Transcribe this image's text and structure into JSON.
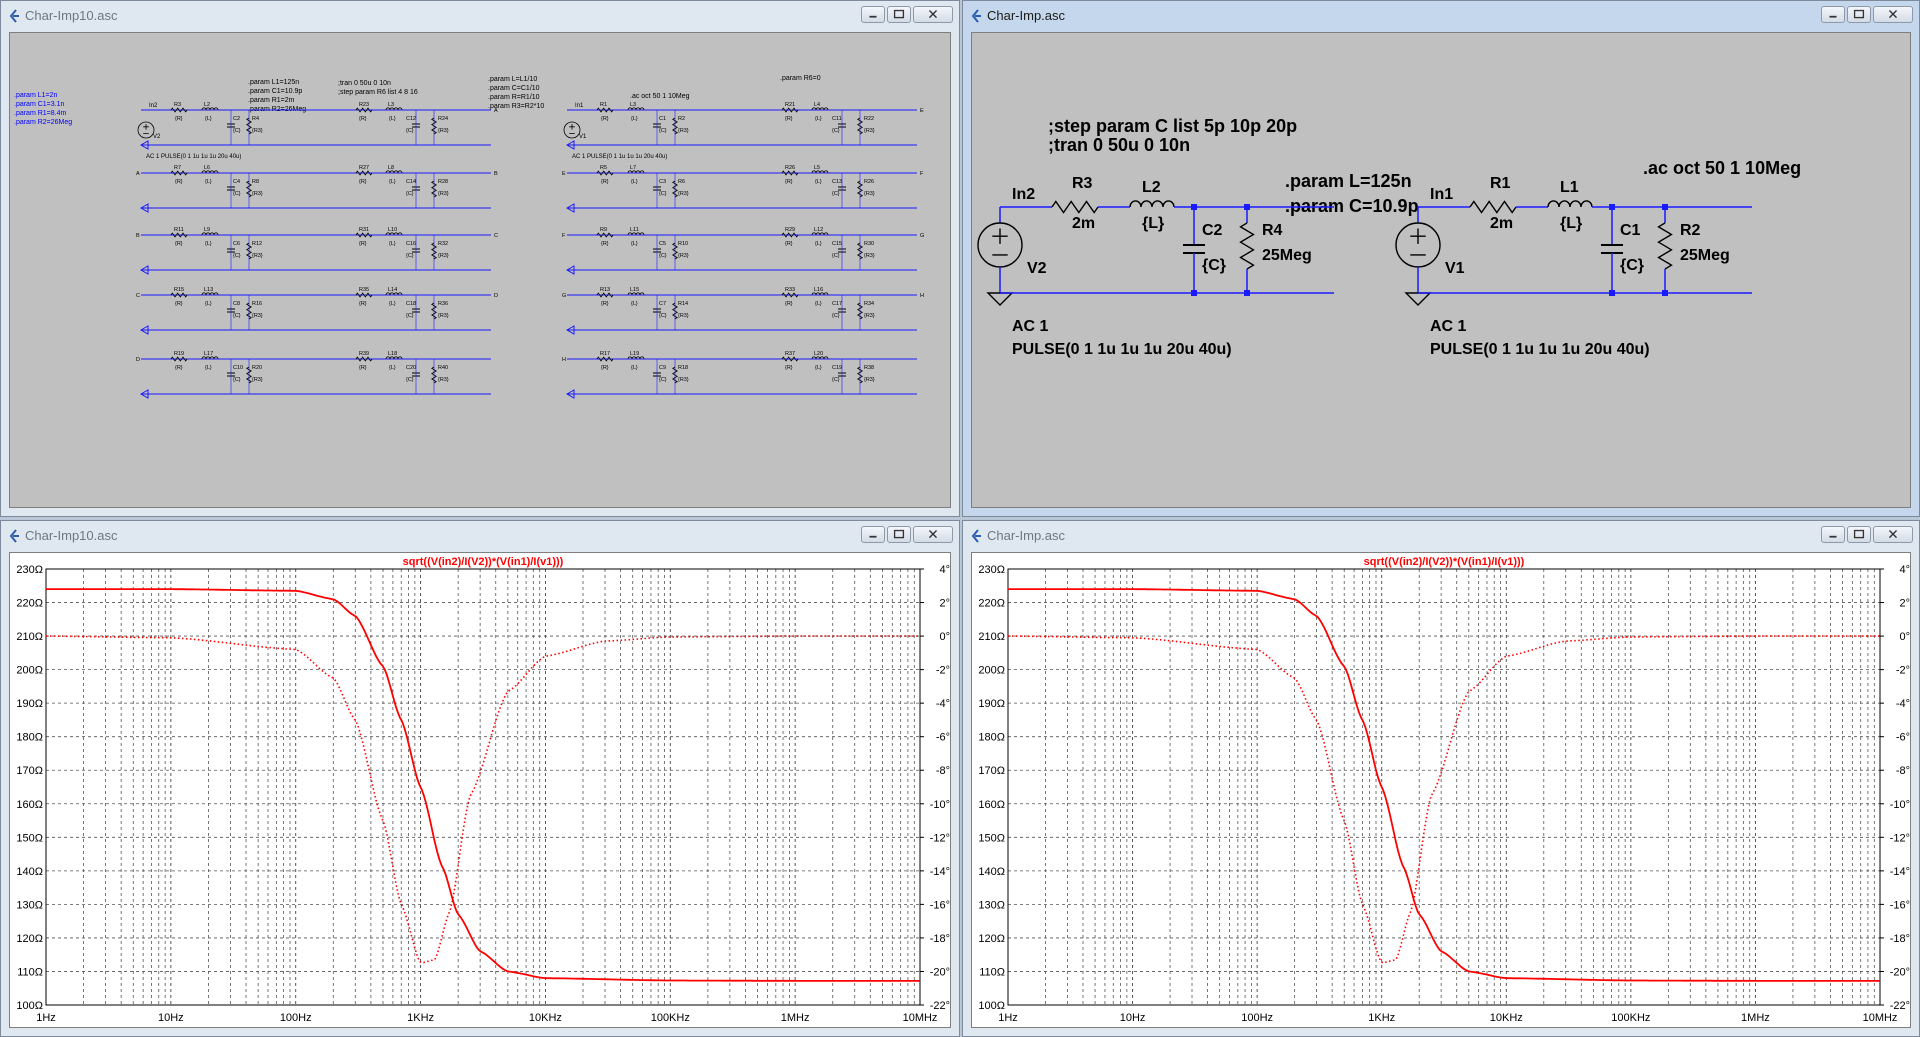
{
  "windows": {
    "top_left": {
      "title": "Char-Imp10.asc"
    },
    "top_right": {
      "title": "Char-Imp.asc"
    },
    "bottom_left": {
      "title": "Char-Imp10.asc"
    },
    "bottom_right": {
      "title": "Char-Imp.asc"
    }
  },
  "schem10": {
    "params_left": [
      ".param L1=2n",
      ".param C1=3.1n",
      ".param R1=8.4m",
      ".param R2=26Meg"
    ],
    "params_mid": [
      ".param L1=125n",
      ".param C1=10.9p",
      ".param R1=2m",
      ".param R2=26Meg"
    ],
    "tran": [
      ";tran 0 50u 0 10n",
      ";step param R6 list 4 8 16"
    ],
    "params_right": [
      ".param L=L1/10",
      ".param C=C1/10",
      ".param R=R1/10",
      ".param R3=R2*10"
    ],
    "ac": ".ac oct 50 1 10Meg",
    "param_r6": ".param R6=0",
    "src_left": "In2",
    "src_left_v": "V2",
    "src_right": "In1",
    "src_right_v": "V1",
    "src_text": "AC 1     PULSE(0 1 1u 1u 1u 20u 40u)",
    "left_rows": [
      {
        "r1": "R3",
        "l1": "L2",
        "c1": "C2",
        "rr1": "R4",
        "r2": "R23",
        "l2": "L3",
        "c2": "C12",
        "rr2": "R24",
        "in": "",
        "out": "A"
      },
      {
        "r1": "R7",
        "l1": "L6",
        "c1": "C4",
        "rr1": "R8",
        "r2": "R27",
        "l2": "L8",
        "c2": "C14",
        "rr2": "R28",
        "in": "A",
        "out": "B"
      },
      {
        "r1": "R11",
        "l1": "L9",
        "c1": "C6",
        "rr1": "R12",
        "r2": "R31",
        "l2": "L10",
        "c2": "C16",
        "rr2": "R32",
        "in": "B",
        "out": "C"
      },
      {
        "r1": "R15",
        "l1": "L13",
        "c1": "C8",
        "rr1": "R16",
        "r2": "R35",
        "l2": "L14",
        "c2": "C18",
        "rr2": "R36",
        "in": "C",
        "out": "D"
      },
      {
        "r1": "R19",
        "l1": "L17",
        "c1": "C10",
        "rr1": "R20",
        "r2": "R39",
        "l2": "L18",
        "c2": "C20",
        "rr2": "R40",
        "in": "D",
        "out": ""
      }
    ],
    "right_rows": [
      {
        "r1": "R1",
        "l1": "L3",
        "c1": "C1",
        "rr1": "R2",
        "r2": "R21",
        "l2": "L4",
        "c2": "C11",
        "rr2": "R22",
        "in": "",
        "out": "E"
      },
      {
        "r1": "R5",
        "l1": "L7",
        "c1": "C3",
        "rr1": "R6",
        "r2": "R26",
        "l2": "L5",
        "c2": "C13",
        "rr2": "R26",
        "in": "E",
        "out": "F"
      },
      {
        "r1": "R9",
        "l1": "L11",
        "c1": "C5",
        "rr1": "R10",
        "r2": "R29",
        "l2": "L12",
        "c2": "C15",
        "rr2": "R30",
        "in": "F",
        "out": "G"
      },
      {
        "r1": "R13",
        "l1": "L15",
        "c1": "C7",
        "rr1": "R14",
        "r2": "R33",
        "l2": "L16",
        "c2": "C17",
        "rr2": "R34",
        "in": "G",
        "out": "H"
      },
      {
        "r1": "R17",
        "l1": "L19",
        "c1": "C9",
        "rr1": "R18",
        "r2": "R37",
        "l2": "L20",
        "c2": "C19",
        "rr2": "R38",
        "in": "H",
        "out": ""
      }
    ],
    "rval": "{R}",
    "lval": "{L}",
    "cval": "{C}",
    "r3val": "{R3}"
  },
  "schem": {
    "step": ";step param C  list  5p 10p 20p",
    "tran": ";tran 0 50u 0 10n",
    "param_l": ".param L=125n",
    "param_c": ".param C=10.9p",
    "ac": ".ac oct 50 1 10Meg",
    "left": {
      "node": "In2",
      "r": "R3",
      "rval": "2m",
      "l": "L2",
      "lval": "{L}",
      "c": "C2",
      "cval": "{C}",
      "rr": "R4",
      "rrval": "25Meg",
      "v": "V2"
    },
    "right": {
      "node": "In1",
      "r": "R1",
      "rval": "2m",
      "l": "L1",
      "lval": "{L}",
      "c": "C1",
      "cval": "{C}",
      "rr": "R2",
      "rrval": "25Meg",
      "v": "V1"
    },
    "ac1": "AC 1",
    "pulse": "PULSE(0 1 1u 1u 1u 20u 40u)"
  },
  "chart_data": [
    {
      "type": "line",
      "title": "sqrt((V(in2)/I(V2))*(V(in1)/I(v1)))",
      "xlabel": "",
      "ylabel": "",
      "x_scale": "log",
      "xlim": [
        1,
        10000000
      ],
      "x_ticks": [
        "1Hz",
        "10Hz",
        "100Hz",
        "1KHz",
        "10KHz",
        "100KHz",
        "1MHz",
        "10MHz"
      ],
      "ylim": [
        100,
        230
      ],
      "y_ticks": [
        "230Ω",
        "220Ω",
        "210Ω",
        "200Ω",
        "190Ω",
        "180Ω",
        "170Ω",
        "160Ω",
        "150Ω",
        "140Ω",
        "130Ω",
        "120Ω",
        "110Ω",
        "100Ω"
      ],
      "y2lim": [
        -22,
        4
      ],
      "y2_ticks": [
        "4°",
        "2°",
        "0°",
        "-2°",
        "-4°",
        "-6°",
        "-8°",
        "-10°",
        "-12°",
        "-14°",
        "-16°",
        "-18°",
        "-20°",
        "-22°"
      ],
      "grid": true,
      "color": "#ff0000",
      "series": [
        {
          "axis": "left",
          "style": "solid",
          "x": [
            1,
            10,
            100,
            200,
            300,
            500,
            700,
            1000,
            1500,
            2000,
            3000,
            5000,
            10000,
            100000,
            1000000,
            10000000
          ],
          "y": [
            224,
            224,
            223.5,
            221,
            216,
            201,
            185,
            165,
            141,
            127,
            116,
            110,
            108,
            107.3,
            107.2,
            107.2
          ]
        },
        {
          "axis": "right",
          "style": "dotted",
          "x": [
            1,
            10,
            100,
            200,
            300,
            500,
            700,
            1000,
            1300,
            1700,
            2500,
            5000,
            10000,
            30000,
            100000,
            1000000,
            10000000
          ],
          "y": [
            0,
            -0.1,
            -0.8,
            -2.5,
            -5,
            -11,
            -16,
            -19.5,
            -19.3,
            -16.5,
            -9.5,
            -3.3,
            -1.2,
            -0.3,
            -0.05,
            0,
            0
          ]
        }
      ]
    },
    {
      "type": "line",
      "title": "sqrt((V(in2)/I(V2))*(V(in1)/I(v1)))",
      "xlabel": "",
      "ylabel": "",
      "x_scale": "log",
      "xlim": [
        1,
        10000000
      ],
      "x_ticks": [
        "1Hz",
        "10Hz",
        "100Hz",
        "1KHz",
        "10KHz",
        "100KHz",
        "1MHz",
        "10MHz"
      ],
      "ylim": [
        100,
        230
      ],
      "y_ticks": [
        "230Ω",
        "220Ω",
        "210Ω",
        "200Ω",
        "190Ω",
        "180Ω",
        "170Ω",
        "160Ω",
        "150Ω",
        "140Ω",
        "130Ω",
        "120Ω",
        "110Ω",
        "100Ω"
      ],
      "y2lim": [
        -22,
        4
      ],
      "y2_ticks": [
        "4°",
        "2°",
        "0°",
        "-2°",
        "-4°",
        "-6°",
        "-8°",
        "-10°",
        "-12°",
        "-14°",
        "-16°",
        "-18°",
        "-20°",
        "-22°"
      ],
      "grid": true,
      "color": "#ff0000",
      "series": [
        {
          "axis": "left",
          "style": "solid",
          "x": [
            1,
            10,
            100,
            200,
            300,
            500,
            700,
            1000,
            1500,
            2000,
            3000,
            5000,
            10000,
            100000,
            1000000,
            10000000
          ],
          "y": [
            224,
            224,
            223.5,
            221,
            216,
            201,
            185,
            165,
            141,
            127,
            116,
            110,
            108,
            107.3,
            107.2,
            107.2
          ]
        },
        {
          "axis": "right",
          "style": "dotted",
          "x": [
            1,
            10,
            100,
            200,
            300,
            500,
            700,
            1000,
            1300,
            1700,
            2500,
            5000,
            10000,
            30000,
            100000,
            1000000,
            10000000
          ],
          "y": [
            0,
            -0.1,
            -0.8,
            -2.5,
            -5,
            -11,
            -16,
            -19.5,
            -19.3,
            -16.5,
            -9.5,
            -3.3,
            -1.2,
            -0.3,
            -0.05,
            0,
            0
          ]
        }
      ]
    }
  ]
}
